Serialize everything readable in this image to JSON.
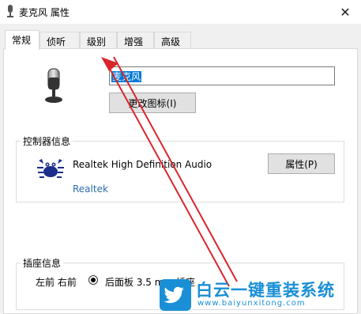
{
  "window": {
    "title": "麦克风 属性",
    "close_glyph": "✕"
  },
  "tabs": [
    {
      "label": "常规",
      "active": true
    },
    {
      "label": "侦听"
    },
    {
      "label": "级别"
    },
    {
      "label": "增强"
    },
    {
      "label": "高级"
    }
  ],
  "device": {
    "name_value": "麦克风",
    "change_icon_label": "更改图标(I)"
  },
  "controller": {
    "group_title": "控制器信息",
    "device_name": "Realtek High Definition Audio",
    "vendor": "Realtek",
    "properties_label": "属性(P)"
  },
  "jack": {
    "group_title": "插座信息",
    "location": "左前 右前",
    "description": "后面板 3.5 mm 插座"
  },
  "watermark": {
    "text": "白云一键重装系统",
    "url": "www.baiyunxitong.com"
  },
  "colors": {
    "selection": "#0078d7",
    "arrow": "#d9262c",
    "watermark": "#1a8fd6"
  }
}
